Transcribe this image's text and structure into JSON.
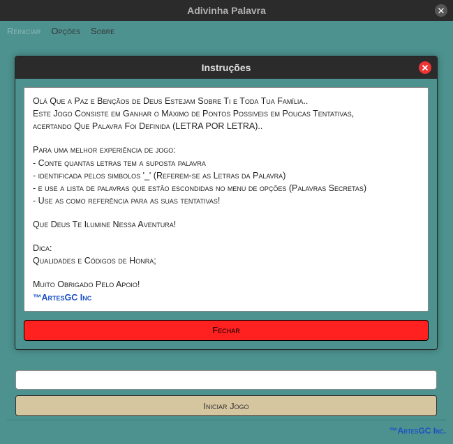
{
  "window": {
    "title": "Adivinha Palavra"
  },
  "menu": {
    "reiniciar": "Reiniciar",
    "opcoes": "Opções",
    "sobre": "Sobre"
  },
  "modal": {
    "title": "Instruções",
    "line1": "Olá Que a Paz e Bençãos de Deus Estejam Sobre Ti e Toda Tua Família..",
    "line2": "Este Jogo Consiste em Ganhar o Máximo de Pontos Possiveis em Poucas Tentativas,",
    "line3": "acertando Que Palavra Foi Definida (LETRA POR LETRA)..",
    "line4": "Para uma melhor experiência de jogo:",
    "line5": "- Conte quantas letras tem a suposta palavra",
    "line6": "- identificada pelos simbolos '_' (Referem-se as Letras da Palavra)",
    "line7": "- e use a lista de palavras que estão escondidas no menu de opções (Palavras Secretas)",
    "line8": "- Use as como referência para as suas tentativas!",
    "line9": "Que Deus Te Ilumine Nessa Aventura!",
    "line10": "Dica:",
    "line11": "Qualidades e Códigos de Honra;",
    "line12": "Muito Obrigado Pelo Apoio!",
    "signature": "™ArtesGC Inc",
    "close_btn": "Fechar"
  },
  "main": {
    "input_value": "",
    "start_btn": "Iniciar Jogo"
  },
  "footer": {
    "brand": "™ArtesGC Inc."
  }
}
